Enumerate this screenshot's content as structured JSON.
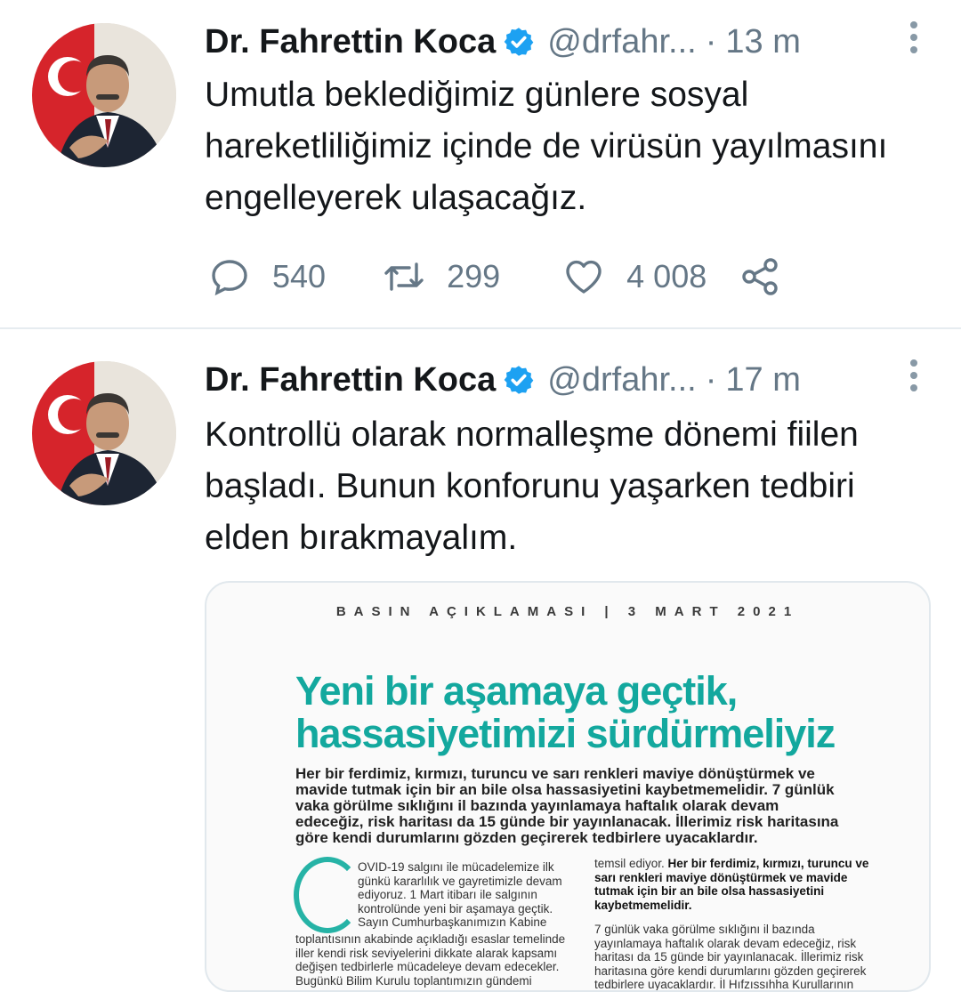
{
  "tweets": [
    {
      "author_name": "Dr. Fahrettin Koca",
      "handle": "@drfahr...",
      "separator": "·",
      "time": "13 m",
      "text": "Umutla beklediğimiz günlere sosyal hareketliliğimiz içinde de virüsün yayılmasını engelleyerek ulaşacağız.",
      "replies": "540",
      "retweets": "299",
      "likes": "4 008"
    },
    {
      "author_name": "Dr. Fahrettin Koca",
      "handle": "@drfahr...",
      "separator": "·",
      "time": "17 m",
      "text": "Kontrollü olarak normalleşme dönemi fiilen başladı. Bunun konforunu yaşarken tedbiri elden bırakmayalım.",
      "media": {
        "header": "BASIN AÇIKLAMASI | 3 MART 2021",
        "headline_line1": "Yeni bir aşamaya geçtik,",
        "headline_line2": "hassasiyetimizi sürdürmeliyiz",
        "lead": "Her bir ferdimiz, kırmızı, turuncu ve sarı renkleri maviye dönüştürmek ve mavide tutmak için bir an bile olsa hassasiyetini kaybetmemelidir. 7 günlük vaka görülme sıklığını il bazında yayınlamaya haftalık olarak devam edeceğiz, risk haritası da 15 günde bir yayınlanacak. İllerimiz risk haritasına göre kendi durumlarını gözden geçirerek tedbirlere uyacaklardır.",
        "col_left_a": "OVID-19 salgını ile mücadelemize ilk günkü kararlılık ve gayretimizle devam ediyoruz. 1 Mart itibarı ile salgının kontrolünde yeni bir aşamaya geçtik. Sayın Cumhurbaşkanımızın Kabine",
        "col_left_b": "toplantısının akabinde açıkladığı esaslar temelinde iller kendi risk seviyelerini dikkate alarak kapsamı değişen tedbirlerle mücadeleye devam edecekler. Bugünkü Bilim Kurulu toplantımızın gündemi",
        "col_right_a": "temsil ediyor.",
        "col_right_b": "Her bir ferdimiz, kırmızı, turuncu ve sarı renkleri maviye dönüştürmek ve mavide tutmak için bir an bile olsa hassasiyetini kaybetmemelidir.",
        "col_right_c": "7 günlük vaka görülme sıklığını il bazında yayınlamaya haftalık olarak devam edeceğiz, risk haritası da 15 günde bir yayınlanacak. İllerimiz risk haritasına göre kendi durumlarını gözden geçirerek tedbirlere uyacaklardır. İl Hıfzıssıhha Kurullarının"
      }
    }
  ],
  "colors": {
    "text": "#14171a",
    "secondary": "#657786",
    "verified": "#1da1f2",
    "headline_teal": "#13a89e",
    "divider": "#e6ecf0"
  },
  "icons": {
    "reply": "reply-icon",
    "retweet": "retweet-icon",
    "like": "heart-icon",
    "share": "share-icon",
    "more": "more-vertical-icon",
    "verified": "verified-badge-icon"
  }
}
